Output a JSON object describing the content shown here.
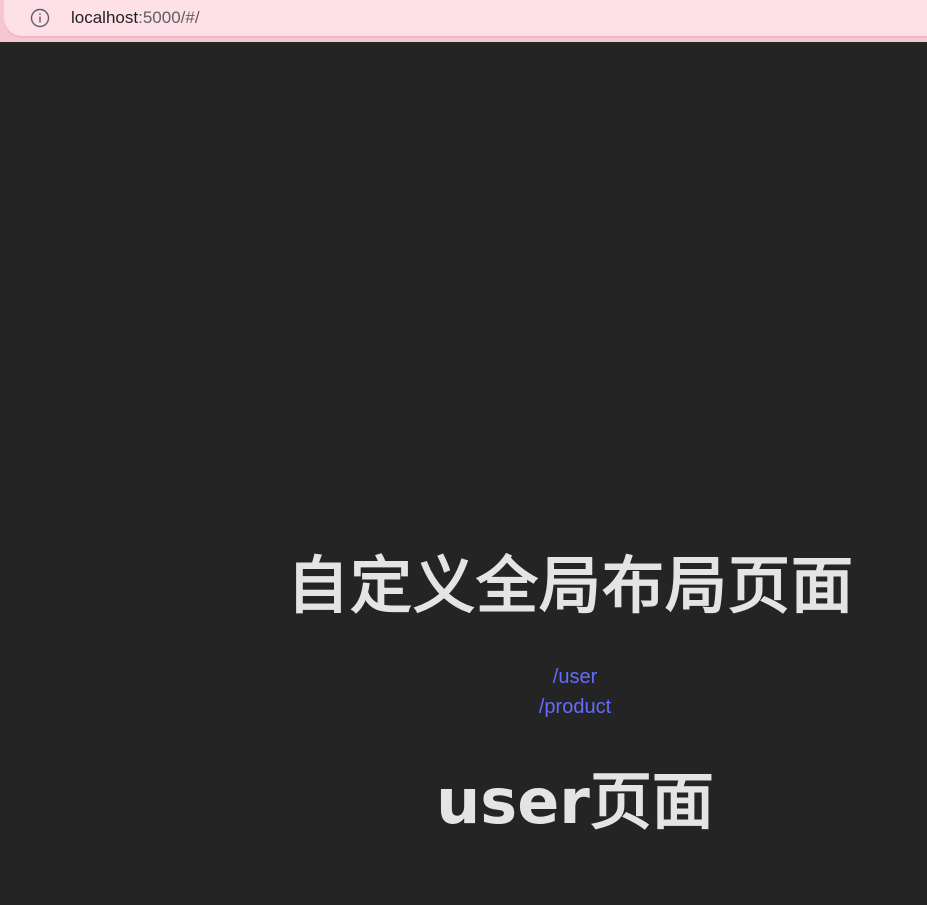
{
  "browser": {
    "url_host": "localhost",
    "url_rest": ":5000/#/",
    "info_icon": "info-icon"
  },
  "layout": {
    "title": "自定义全局布局页面"
  },
  "nav": {
    "links": [
      {
        "label": "/user"
      },
      {
        "label": "/product"
      }
    ]
  },
  "page": {
    "title": "user页面"
  },
  "colors": {
    "background": "#242424",
    "text": "#e4e4e4",
    "link": "#646cff",
    "address_bar": "#fde0e8"
  }
}
